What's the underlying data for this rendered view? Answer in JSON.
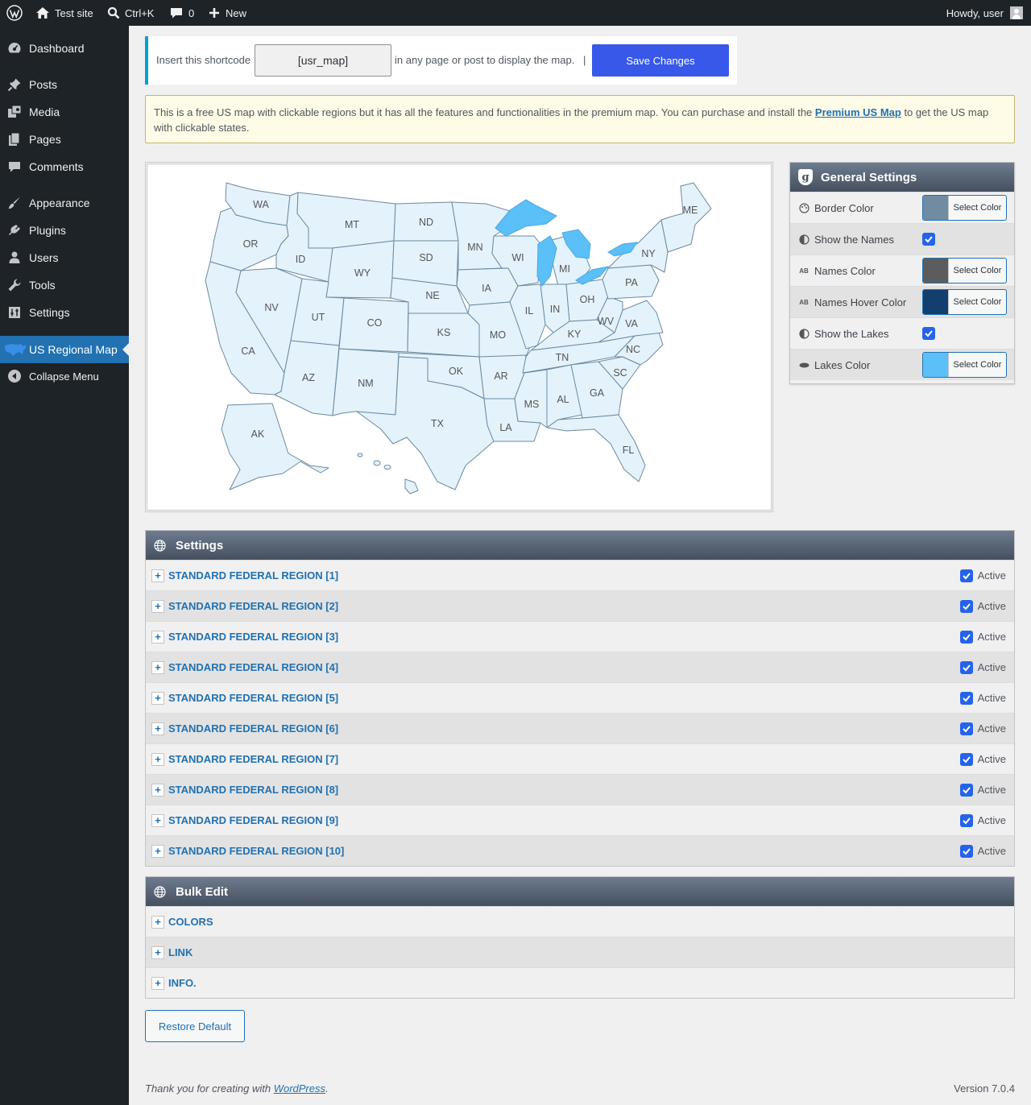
{
  "adminbar": {
    "site": "Test site",
    "search_shortcut": "Ctrl+K",
    "comments_count": "0",
    "new_label": "New",
    "howdy": "Howdy, user"
  },
  "sidebar": {
    "items": [
      {
        "label": "Dashboard",
        "icon": "dashboard-icon"
      },
      {
        "label": "Posts",
        "icon": "pin-icon"
      },
      {
        "label": "Media",
        "icon": "media-icon"
      },
      {
        "label": "Pages",
        "icon": "pages-icon"
      },
      {
        "label": "Comments",
        "icon": "comment-icon"
      },
      {
        "label": "Appearance",
        "icon": "brush-icon"
      },
      {
        "label": "Plugins",
        "icon": "plugin-icon"
      },
      {
        "label": "Users",
        "icon": "user-icon"
      },
      {
        "label": "Tools",
        "icon": "wrench-icon"
      },
      {
        "label": "Settings",
        "icon": "settings-icon"
      },
      {
        "label": "US Regional Map",
        "icon": "us-map-icon",
        "current": true
      },
      {
        "label": "Collapse Menu",
        "icon": "collapse-icon"
      }
    ]
  },
  "shortcode": {
    "prefix": "Insert this shortcode",
    "value": "[usr_map]",
    "suffix": "in any page or post to display the map.",
    "separator": "|",
    "save_label": "Save Changes"
  },
  "notice": {
    "text_before": "This is a free US map with clickable regions but it has all the features and functionalities in the premium map. You can purchase and install the ",
    "link": "Premium US Map",
    "text_after": " to get the US map with clickable states."
  },
  "map": {
    "states": [
      {
        "abbr": "WA"
      },
      {
        "abbr": "OR"
      },
      {
        "abbr": "CA"
      },
      {
        "abbr": "ID"
      },
      {
        "abbr": "NV"
      },
      {
        "abbr": "MT"
      },
      {
        "abbr": "WY"
      },
      {
        "abbr": "UT"
      },
      {
        "abbr": "AZ"
      },
      {
        "abbr": "CO"
      },
      {
        "abbr": "NM"
      },
      {
        "abbr": "ND"
      },
      {
        "abbr": "SD"
      },
      {
        "abbr": "NE"
      },
      {
        "abbr": "KS"
      },
      {
        "abbr": "OK"
      },
      {
        "abbr": "TX"
      },
      {
        "abbr": "MN"
      },
      {
        "abbr": "IA"
      },
      {
        "abbr": "MO"
      },
      {
        "abbr": "AR"
      },
      {
        "abbr": "LA"
      },
      {
        "abbr": "WI"
      },
      {
        "abbr": "IL"
      },
      {
        "abbr": "MI"
      },
      {
        "abbr": "IN"
      },
      {
        "abbr": "OH"
      },
      {
        "abbr": "KY"
      },
      {
        "abbr": "TN"
      },
      {
        "abbr": "MS"
      },
      {
        "abbr": "AL"
      },
      {
        "abbr": "GA"
      },
      {
        "abbr": "FL"
      },
      {
        "abbr": "SC"
      },
      {
        "abbr": "NC"
      },
      {
        "abbr": "VA"
      },
      {
        "abbr": "WV"
      },
      {
        "abbr": "PA"
      },
      {
        "abbr": "NY"
      },
      {
        "abbr": "ME"
      },
      {
        "abbr": "AK"
      }
    ],
    "land_color": "#e4f2fc",
    "border_color": "#6b8aa0",
    "lakes_color": "#5bc0f8"
  },
  "general_settings": {
    "title": "General Settings",
    "rows": [
      {
        "label": "Border Color",
        "type": "color",
        "color": "#6f8ca3",
        "btn": "Select Color",
        "icon": "palette-icon"
      },
      {
        "label": "Show the Names",
        "type": "check",
        "icon": "contrast-icon"
      },
      {
        "label": "Names Color",
        "type": "color",
        "color": "#5c5c5c",
        "btn": "Select Color",
        "icon": "text-ab-icon"
      },
      {
        "label": "Names Hover Color",
        "type": "color",
        "color": "#133f6f",
        "btn": "Select Color",
        "icon": "text-ab-icon"
      },
      {
        "label": "Show the Lakes",
        "type": "check",
        "icon": "contrast-icon"
      },
      {
        "label": "Lakes Color",
        "type": "color",
        "color": "#5bc0f8",
        "btn": "Select Color",
        "icon": "lake-icon"
      }
    ]
  },
  "settings": {
    "title": "Settings",
    "active_label": "Active",
    "regions": [
      "STANDARD FEDERAL REGION [1]",
      "STANDARD FEDERAL REGION [2]",
      "STANDARD FEDERAL REGION [3]",
      "STANDARD FEDERAL REGION [4]",
      "STANDARD FEDERAL REGION [5]",
      "STANDARD FEDERAL REGION [6]",
      "STANDARD FEDERAL REGION [7]",
      "STANDARD FEDERAL REGION [8]",
      "STANDARD FEDERAL REGION [9]",
      "STANDARD FEDERAL REGION [10]"
    ]
  },
  "bulk_edit": {
    "title": "Bulk Edit",
    "items": [
      "COLORS",
      "LINK",
      "INFO."
    ]
  },
  "restore_label": "Restore Default",
  "footer": {
    "thanks_before": "Thank you for creating with ",
    "wp_link": "WordPress",
    "thanks_after": ".",
    "version": "Version 7.0.4"
  }
}
